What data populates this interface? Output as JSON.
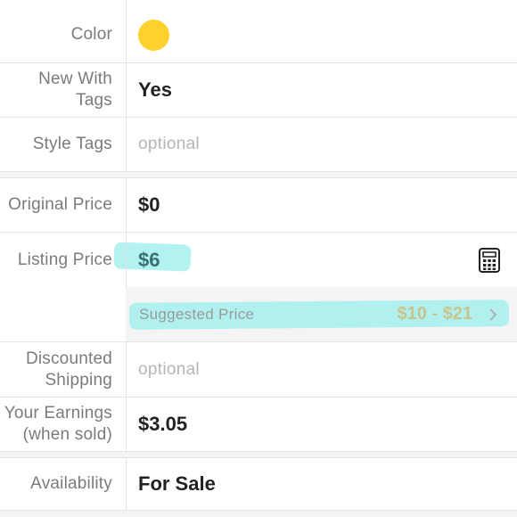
{
  "rows": {
    "color": {
      "label": "Color",
      "value_color": "#fdd12e"
    },
    "new_with_tags": {
      "label_line1": "New With",
      "label_line2": "Tags",
      "value": "Yes"
    },
    "style_tags": {
      "label": "Style Tags",
      "placeholder": "optional"
    },
    "original_price": {
      "label": "Original Price",
      "value": "$0"
    },
    "listing_price": {
      "label": "Listing Price",
      "value": "$6",
      "suggested_label": "Suggested Price",
      "suggested_range": "$10 - $21",
      "icon": "calculator-icon"
    },
    "discounted_shipping": {
      "label_line1": "Discounted",
      "label_line2": "Shipping",
      "placeholder": "optional"
    },
    "earnings": {
      "label_line1": "Your Earnings",
      "label_line2": "(when sold)",
      "value": "$3.05"
    },
    "availability": {
      "label": "Availability",
      "value": "For Sale"
    }
  },
  "colors": {
    "highlight": "#9ff0ef",
    "suggested_range": "#c9c48f",
    "label": "#7b7b7b"
  }
}
